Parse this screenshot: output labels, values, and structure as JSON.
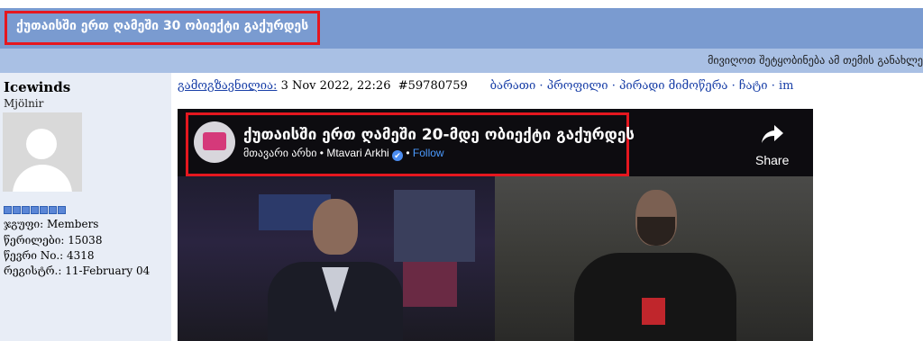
{
  "thread": {
    "title": "ქუთაისში ერთ ღამეში 30 ობიექტი გაქურდეს",
    "subbar_text": "მივიღოთ შეტყობინება ამ თემის განახლე"
  },
  "user": {
    "name": "Icewinds",
    "title": "Mjölnir",
    "pips": 7,
    "group_label": "ჯგუფი:",
    "group_value": "Members",
    "posts_label": "წერილები:",
    "posts_value": "15038",
    "member_no_label": "წევრი No.:",
    "member_no_value": "4318",
    "registered_label": "რეგისტრ.:",
    "registered_value": "11-February 04"
  },
  "post": {
    "posted_label": "გამოგზავნილია:",
    "posted_date": "3 Nov 2022, 22:26",
    "post_id": "#59780759",
    "actions": {
      "warn": "ბარათი",
      "profile": "პროფილი",
      "pm": "პირადი მიმოწერა",
      "chat": "ჩატი",
      "im": "im"
    }
  },
  "embed": {
    "title": "ქუთაისში ერთ ღამეში 20-მდე ობიექტი გაქურდეს",
    "source_ka": "მთავარი არხი",
    "source_en": "Mtavari Arkhi",
    "verified": "✔",
    "follow": "Follow",
    "share": "Share"
  },
  "colors": {
    "titlebar": "#7a9bd0",
    "subbar": "#a9c0e4",
    "highlight": "#e5171f",
    "link": "#1a40a8"
  }
}
